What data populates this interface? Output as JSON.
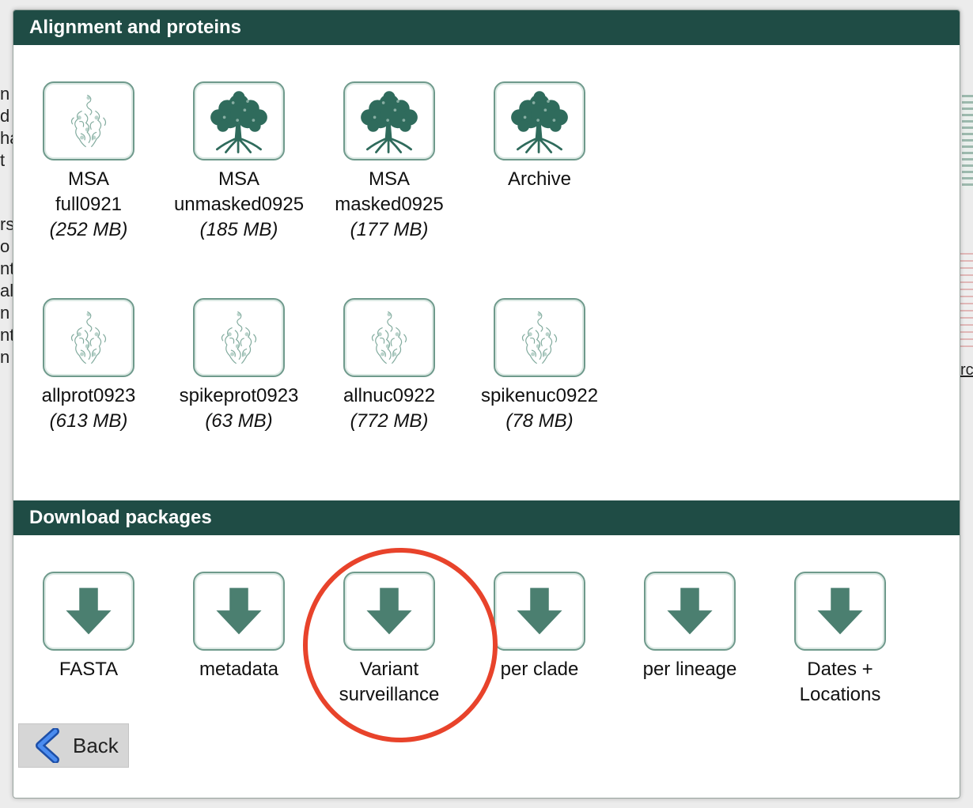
{
  "background": {
    "left_fragments": [
      "n",
      "d",
      "ha",
      "t",
      "",
      "rs",
      "o",
      "nt",
      "al",
      "n",
      "nt",
      "n"
    ],
    "right_link_fragment": "rc"
  },
  "sections": {
    "alignment": {
      "title": "Alignment and proteins",
      "items": [
        {
          "label": "MSA",
          "label2": "full0921",
          "size": "(252 MB)",
          "icon": "protein-structure-icon"
        },
        {
          "label": "MSA",
          "label2": "unmasked0925",
          "size": "(185 MB)",
          "icon": "tree-icon"
        },
        {
          "label": "MSA",
          "label2": "masked0925",
          "size": "(177 MB)",
          "icon": "tree-icon"
        },
        {
          "label": "Archive",
          "label2": "",
          "size": "",
          "icon": "tree-icon"
        },
        {
          "label": "allprot0923",
          "label2": "",
          "size": "(613 MB)",
          "icon": "protein-structure-icon"
        },
        {
          "label": "spikeprot0923",
          "label2": "",
          "size": "(63 MB)",
          "icon": "protein-structure-icon"
        },
        {
          "label": "allnuc0922",
          "label2": "",
          "size": "(772 MB)",
          "icon": "protein-structure-icon"
        },
        {
          "label": "spikenuc0922",
          "label2": "",
          "size": "(78 MB)",
          "icon": "protein-structure-icon"
        }
      ]
    },
    "downloads": {
      "title": "Download packages",
      "items": [
        {
          "label": "FASTA",
          "label2": "",
          "icon": "download-arrow-icon"
        },
        {
          "label": "metadata",
          "label2": "",
          "icon": "download-arrow-icon"
        },
        {
          "label": "Variant",
          "label2": "surveillance",
          "icon": "download-arrow-icon"
        },
        {
          "label": "per clade",
          "label2": "",
          "icon": "download-arrow-icon"
        },
        {
          "label": "per lineage",
          "label2": "",
          "icon": "download-arrow-icon"
        },
        {
          "label": "Dates +",
          "label2": "Locations",
          "icon": "download-arrow-icon"
        }
      ]
    }
  },
  "back_button": {
    "label": "Back"
  },
  "colors": {
    "header_bg": "#1f4c45",
    "icon_green": "#4b7f70",
    "highlight": "#e8432b",
    "back_chevron": "#2f6fd8"
  }
}
